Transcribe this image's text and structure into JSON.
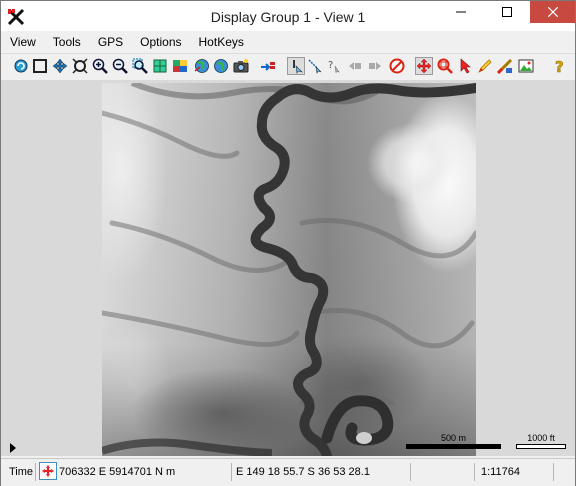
{
  "window": {
    "title": "Display Group 1 - View 1"
  },
  "menu": [
    "View",
    "Tools",
    "GPS",
    "Options",
    "HotKeys"
  ],
  "toolbar_icons": [
    "redraw-icon",
    "select-extents-icon",
    "pan-icon",
    "full-view-icon",
    "zoom-in-icon",
    "zoom-out-icon",
    "zoom-box-icon",
    "zoom-layer-icon",
    "layer-controls-icon",
    "globe-icon",
    "camera-icon",
    "add-layer-icon",
    "locate-icon",
    "measure-icon",
    "help-cursor-icon",
    "back-icon",
    "forward-icon",
    "cancel-icon",
    "move-icon",
    "zoom-select-icon",
    "pointer-icon",
    "pencil-icon",
    "edit-icon",
    "image-icon",
    "help-icon"
  ],
  "scalebar": {
    "metric_label": "500 m",
    "imperial_label": "1000 ft"
  },
  "status": {
    "mode_label": "Time",
    "projected_coords": "706332 E  5914701 N m",
    "geographic_coords": "E 149 18 55.7  S 36 53 28.1",
    "scale": "1:11764"
  },
  "colors": {
    "close_button": "#c7493f",
    "canvas_bg": "#d9d9d9",
    "accent": "#3d8ec9"
  }
}
